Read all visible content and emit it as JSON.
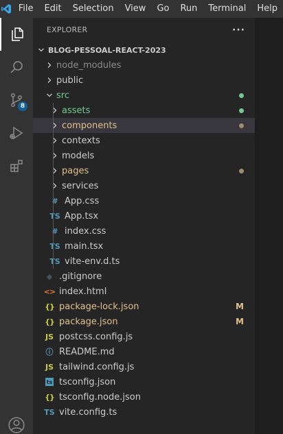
{
  "menu": [
    "File",
    "Edit",
    "Selection",
    "View",
    "Go",
    "Run",
    "Terminal",
    "Help"
  ],
  "activity": {
    "scm_badge": "8"
  },
  "explorer": {
    "title": "EXPLORER",
    "more": "···",
    "project": "BLOG-PESSOAL-REACT-2023"
  },
  "tree": [
    {
      "name": "node_modules",
      "type": "folder",
      "depth": 1,
      "color": "#8c8c8c",
      "chevron": "right"
    },
    {
      "name": "public",
      "type": "folder",
      "depth": 1,
      "color": "#cccccc",
      "chevron": "right"
    },
    {
      "name": "src",
      "type": "folder",
      "depth": 1,
      "color": "#73c991",
      "chevron": "down",
      "dot": "#73c991"
    },
    {
      "name": "assets",
      "type": "folder",
      "depth": 2,
      "color": "#73c991",
      "chevron": "right",
      "dot": "#73c991"
    },
    {
      "name": "components",
      "type": "folder",
      "depth": 2,
      "color": "#e2c08d",
      "chevron": "right",
      "dot": "#a08c6c",
      "selected": true
    },
    {
      "name": "contexts",
      "type": "folder",
      "depth": 2,
      "color": "#cccccc",
      "chevron": "right"
    },
    {
      "name": "models",
      "type": "folder",
      "depth": 2,
      "color": "#cccccc",
      "chevron": "right"
    },
    {
      "name": "pages",
      "type": "folder",
      "depth": 2,
      "color": "#e2c08d",
      "chevron": "right",
      "dot": "#a08c6c"
    },
    {
      "name": "services",
      "type": "folder",
      "depth": 2,
      "color": "#cccccc",
      "chevron": "right"
    },
    {
      "name": "App.css",
      "type": "file",
      "depth": 2,
      "icon": "#",
      "icon_color": "#519aba",
      "color": "#cccccc"
    },
    {
      "name": "App.tsx",
      "type": "file",
      "depth": 2,
      "icon": "TS",
      "icon_color": "#519aba",
      "color": "#cccccc"
    },
    {
      "name": "index.css",
      "type": "file",
      "depth": 2,
      "icon": "#",
      "icon_color": "#519aba",
      "color": "#cccccc"
    },
    {
      "name": "main.tsx",
      "type": "file",
      "depth": 2,
      "icon": "TS",
      "icon_color": "#519aba",
      "color": "#cccccc"
    },
    {
      "name": "vite-env.d.ts",
      "type": "file",
      "depth": 2,
      "icon": "TS",
      "icon_color": "#519aba",
      "color": "#cccccc"
    },
    {
      "name": ".gitignore",
      "type": "file",
      "depth": 1,
      "icon": "◆",
      "icon_color": "#41535b",
      "color": "#cccccc"
    },
    {
      "name": "index.html",
      "type": "file",
      "depth": 1,
      "icon": "<>",
      "icon_color": "#e37933",
      "color": "#cccccc"
    },
    {
      "name": "package-lock.json",
      "type": "file",
      "depth": 1,
      "icon": "{}",
      "icon_color": "#cbcb41",
      "color": "#e2c08d",
      "flag": "M"
    },
    {
      "name": "package.json",
      "type": "file",
      "depth": 1,
      "icon": "{}",
      "icon_color": "#cbcb41",
      "color": "#e2c08d",
      "flag": "M"
    },
    {
      "name": "postcss.config.js",
      "type": "file",
      "depth": 1,
      "icon": "JS",
      "icon_color": "#cbcb41",
      "color": "#cccccc"
    },
    {
      "name": "README.md",
      "type": "file",
      "depth": 1,
      "icon": "ⓘ",
      "icon_color": "#519aba",
      "color": "#cccccc"
    },
    {
      "name": "tailwind.config.js",
      "type": "file",
      "depth": 1,
      "icon": "JS",
      "icon_color": "#cbcb41",
      "color": "#cccccc"
    },
    {
      "name": "tsconfig.json",
      "type": "file",
      "depth": 1,
      "icon": "ts",
      "icon_color": "#519aba",
      "color": "#cccccc",
      "boxed": true
    },
    {
      "name": "tsconfig.node.json",
      "type": "file",
      "depth": 1,
      "icon": "{}",
      "icon_color": "#cbcb41",
      "color": "#cccccc"
    },
    {
      "name": "vite.config.ts",
      "type": "file",
      "depth": 1,
      "icon": "TS",
      "icon_color": "#519aba",
      "color": "#cccccc"
    }
  ]
}
